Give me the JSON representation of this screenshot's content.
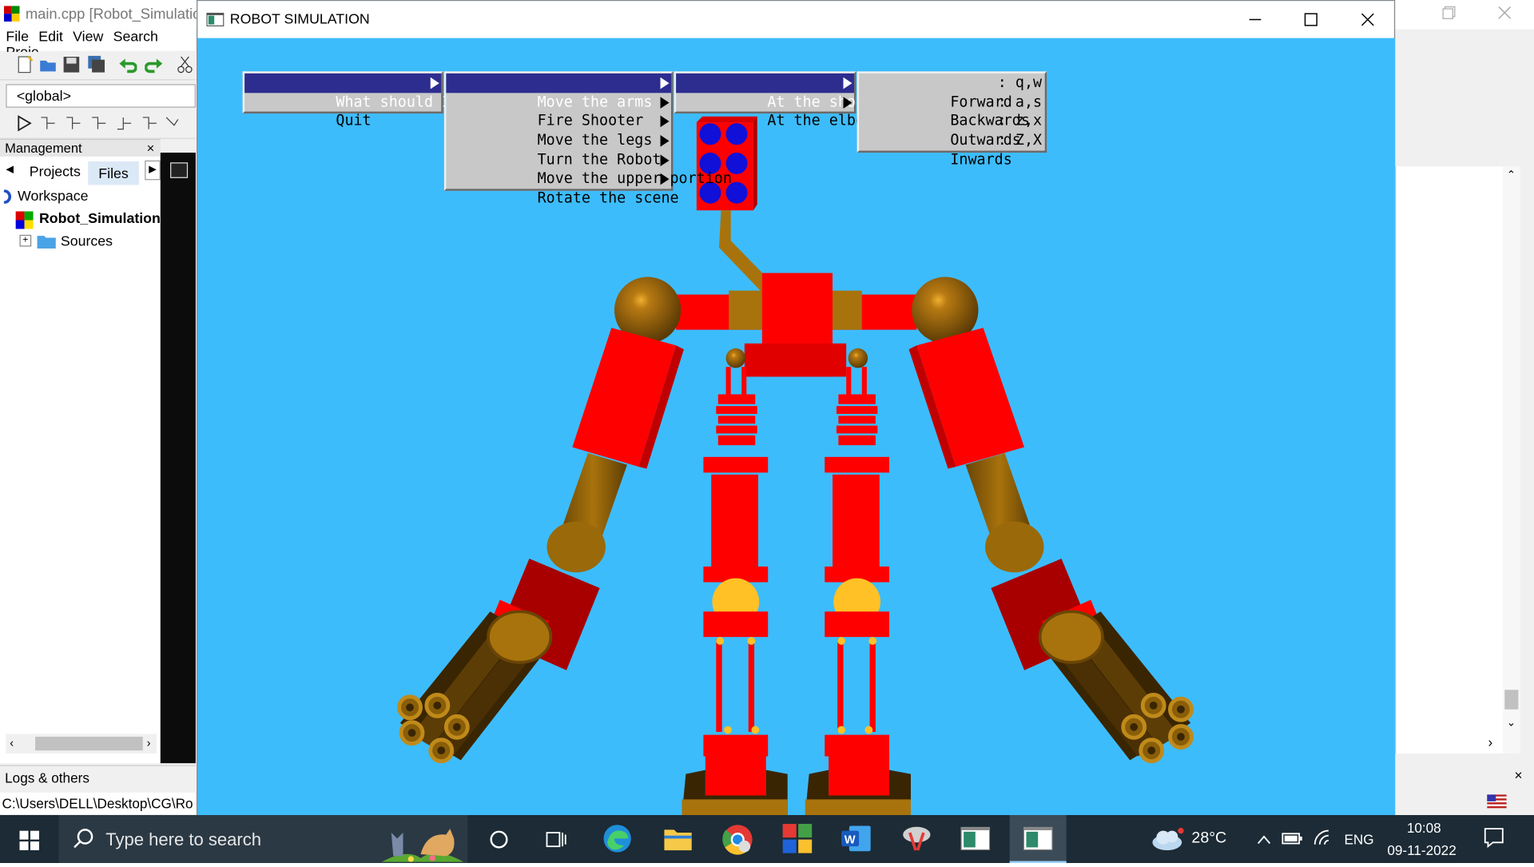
{
  "ide": {
    "title": "main.cpp [Robot_Simulatio",
    "menu": [
      "File",
      "Edit",
      "View",
      "Search",
      "Proje"
    ],
    "global_combo": "<global>",
    "management": {
      "title": "Management",
      "close": "×",
      "tabs": [
        "Projects",
        "Files"
      ],
      "tree": {
        "workspace": "Workspace",
        "project": "Robot_Simulation",
        "sources": "Sources"
      }
    },
    "logs_title": "Logs & others",
    "path": "C:\\Users\\DELL\\Desktop\\CG\\Ro"
  },
  "glut_window": {
    "title": "ROBOT SIMULATION",
    "menus": {
      "main": [
        {
          "label": "What should I do...",
          "submenu": true,
          "highlighted": true
        },
        {
          "label": "Quit",
          "submenu": false,
          "highlighted": false
        }
      ],
      "actions": [
        {
          "label": "Move the arms",
          "submenu": true,
          "highlighted": true
        },
        {
          "label": "Fire Shooter",
          "submenu": true,
          "highlighted": false
        },
        {
          "label": "Move the legs",
          "submenu": true,
          "highlighted": false
        },
        {
          "label": "Turn the Robot",
          "submenu": true,
          "highlighted": false
        },
        {
          "label": "Move the upper portion",
          "submenu": true,
          "highlighted": false
        },
        {
          "label": "Rotate the scene",
          "submenu": true,
          "highlighted": false
        }
      ],
      "arms": [
        {
          "label": "At the shoulders",
          "submenu": true,
          "highlighted": true
        },
        {
          "label": "At the elbows",
          "submenu": true,
          "highlighted": false
        }
      ],
      "shoulders": [
        {
          "label": "Forward",
          "key": ": q,w"
        },
        {
          "label": "Backwards",
          "key": ": a,s"
        },
        {
          "label": "Outwards",
          "key": ": z,x"
        },
        {
          "label": "Inwards",
          "key": ": Z,X"
        }
      ]
    }
  },
  "taskbar": {
    "search_placeholder": "Type here to search",
    "weather": "28°C",
    "language": "ENG",
    "time": "10:08",
    "date": "09-11-2022"
  },
  "colors": {
    "scene_background": "#3dbcfb",
    "robot_red": "#ff0000",
    "robot_bronze": "#a8730c",
    "menu_highlight": "#2d2d90",
    "taskbar": "#1c2b35"
  }
}
